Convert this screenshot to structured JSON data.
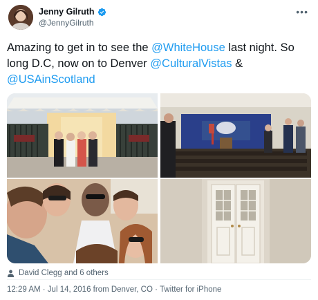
{
  "user": {
    "name": "Jenny Gilruth",
    "handle": "@JennyGilruth"
  },
  "tweet": {
    "part1": "Amazing to get in to see the ",
    "mention1": "@WhiteHouse",
    "part2": " last night. So long D.C, now on to Denver ",
    "mention2": "@CulturalVistas",
    "part3": " & ",
    "mention3": "@USAinScotland"
  },
  "media": {
    "photos": [
      "white-house-entrance-group",
      "press-briefing-room",
      "group-selfie",
      "double-doors"
    ]
  },
  "tagged": {
    "icon": "person-icon",
    "text": "David Clegg and 6 others"
  },
  "meta": {
    "text": "12:29 AM · Jul 14, 2016 from Denver, CO · Twitter for iPhone"
  },
  "colors": {
    "accent": "#1d9bf0",
    "text": "#0f1419",
    "secondary": "#536471"
  }
}
